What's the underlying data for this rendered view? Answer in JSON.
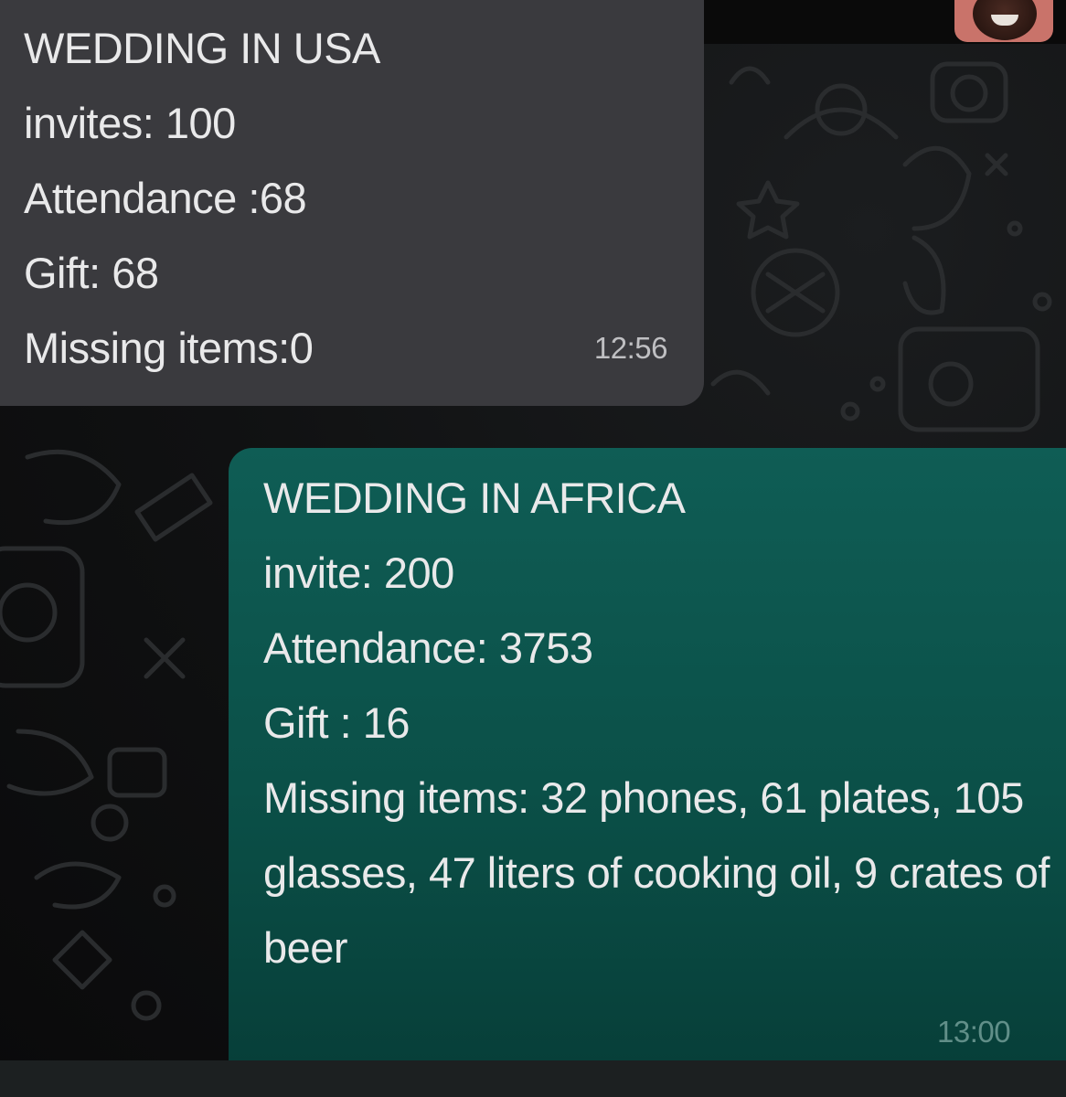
{
  "incoming_message": {
    "title": "WEDDING IN USA",
    "line1": "invites: 100",
    "line2": "Attendance :68",
    "line3": "Gift: 68",
    "line4": "Missing items:0",
    "time": "12:56"
  },
  "outgoing_message": {
    "title": "WEDDING IN AFRICA",
    "line1": "invite: 200",
    "line2": "Attendance: 3753",
    "line3": "Gift : 16",
    "line4": "Missing items: 32 phones,  61 plates, 105 glasses, 47 liters of cooking oil, 9 crates of beer",
    "time": "13:00"
  },
  "colors": {
    "incoming_bubble": "#3a3a3e",
    "outgoing_bubble": "#0b5048",
    "chat_background": "#101112"
  },
  "icons": [
    "avatar",
    "chat-wallpaper-doodles"
  ]
}
